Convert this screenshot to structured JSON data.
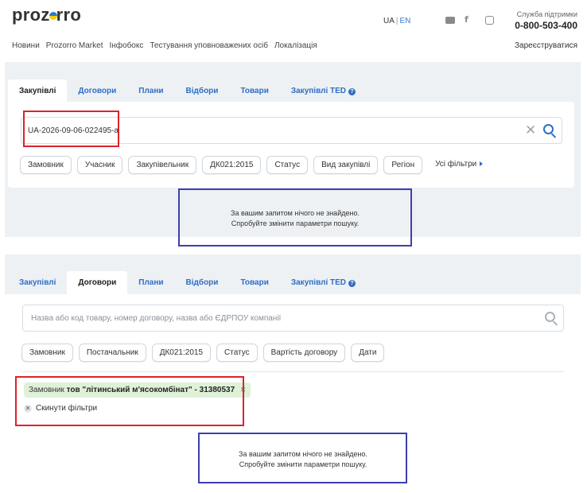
{
  "header": {
    "logo_text": "prozorro",
    "lang_ua": "UA",
    "lang_sep": "|",
    "lang_en": "EN",
    "support_label": "Служба підтримки",
    "support_phone": "0-800-503-400",
    "register": "Зареєструватися",
    "nav": [
      "Новини",
      "Prozorro Market",
      "Інфобокс",
      "Тестування уповноважених осіб",
      "Локалізація"
    ]
  },
  "top": {
    "tabs": [
      "Закупівлі",
      "Договори",
      "Плани",
      "Відбори",
      "Товари",
      "Закупівлі TED"
    ],
    "active_tab": "Закупівлі",
    "search_value": "UA-2026-09-06-022495-a",
    "chips": [
      "Замовник",
      "Учасник",
      "Закупівельник",
      "ДК021:2015",
      "Статус",
      "Вид закупівлі",
      "Регіон"
    ],
    "all_filters": "Усі фільтри",
    "message_line1": "За вашим запитом нічого не знайдено.",
    "message_line2": "Спробуйте змінити параметри пошуку."
  },
  "bottom": {
    "tabs": [
      "Закупівлі",
      "Договори",
      "Плани",
      "Відбори",
      "Товари",
      "Закупівлі TED"
    ],
    "active_tab": "Договори",
    "search_placeholder": "Назва або код товару, номер договору, назва або ЄДРПОУ компанії",
    "chips": [
      "Замовник",
      "Постачальник",
      "ДК021:2015",
      "Статус",
      "Вартість договору",
      "Дати"
    ],
    "filter_label": "Замовник",
    "filter_value": "тов \"літинський м'ясокомбінат\" - 31380537",
    "reset_label": "Скинути фільтри",
    "message_line1": "За вашим запитом нічого не знайдено.",
    "message_line2": "Спробуйте змінити параметри пошуку."
  },
  "colors": {
    "accent": "#2f6ec3",
    "highlight_red": "#d9232e",
    "highlight_blue": "#3b3fb0",
    "filter_bg": "#dff2d8"
  },
  "icons": [
    "youtube-icon",
    "facebook-icon",
    "instagram-icon",
    "info-icon",
    "clear-icon",
    "search-icon",
    "chevron-right-icon",
    "close-icon"
  ]
}
